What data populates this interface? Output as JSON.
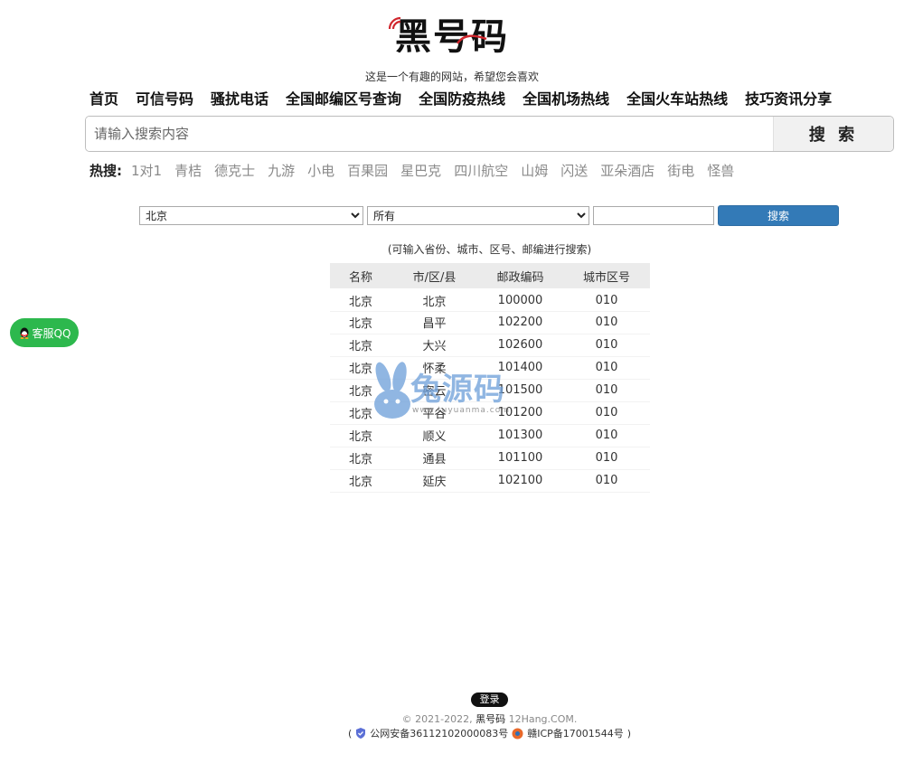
{
  "site": {
    "logo_text": "黑号码",
    "tagline": "这是一个有趣的网站，希望您会喜欢"
  },
  "nav": [
    {
      "label": "首页"
    },
    {
      "label": "可信号码"
    },
    {
      "label": "骚扰电话"
    },
    {
      "label": "全国邮编区号查询"
    },
    {
      "label": "全国防疫热线"
    },
    {
      "label": "全国机场热线"
    },
    {
      "label": "全国火车站热线"
    },
    {
      "label": "技巧资讯分享"
    }
  ],
  "search": {
    "placeholder": "请输入搜索内容",
    "button_label": "搜 索"
  },
  "hot": {
    "label": "热搜:",
    "items": [
      "1对1",
      "青桔",
      "德克士",
      "九游",
      "小电",
      "百果园",
      "星巴克",
      "四川航空",
      "山姆",
      "闪送",
      "亚朵酒店",
      "街电",
      "怪兽"
    ]
  },
  "query": {
    "province_selected": "北京",
    "city_selected": "所有",
    "keyword_value": "",
    "button_label": "搜索",
    "hint": "(可输入省份、城市、区号、邮编进行搜索)"
  },
  "table": {
    "headers": [
      "名称",
      "市/区/县",
      "邮政编码",
      "城市区号"
    ],
    "rows": [
      [
        "北京",
        "北京",
        "100000",
        "010"
      ],
      [
        "北京",
        "昌平",
        "102200",
        "010"
      ],
      [
        "北京",
        "大兴",
        "102600",
        "010"
      ],
      [
        "北京",
        "怀柔",
        "101400",
        "010"
      ],
      [
        "北京",
        "密云",
        "101500",
        "010"
      ],
      [
        "北京",
        "平谷",
        "101200",
        "010"
      ],
      [
        "北京",
        "顺义",
        "101300",
        "010"
      ],
      [
        "北京",
        "通县",
        "101100",
        "010"
      ],
      [
        "北京",
        "延庆",
        "102100",
        "010"
      ]
    ]
  },
  "watermark": {
    "text": "兔源码",
    "sub": "www.tuyuanma.com"
  },
  "float": {
    "qq_label": "客服QQ"
  },
  "footer": {
    "login_label": "登录",
    "copyright_prefix": "© 2021-2022,",
    "brand": "黑号码",
    "domain": "12Hang.COM.",
    "open_paren": "(",
    "police_record": "公网安备36112102000083号",
    "icp_record": "赣ICP备17001544号",
    "close_paren": ")"
  },
  "colors": {
    "accent": "#337ab7",
    "qq_green": "#2db84d",
    "logo_red": "#d0262d"
  }
}
